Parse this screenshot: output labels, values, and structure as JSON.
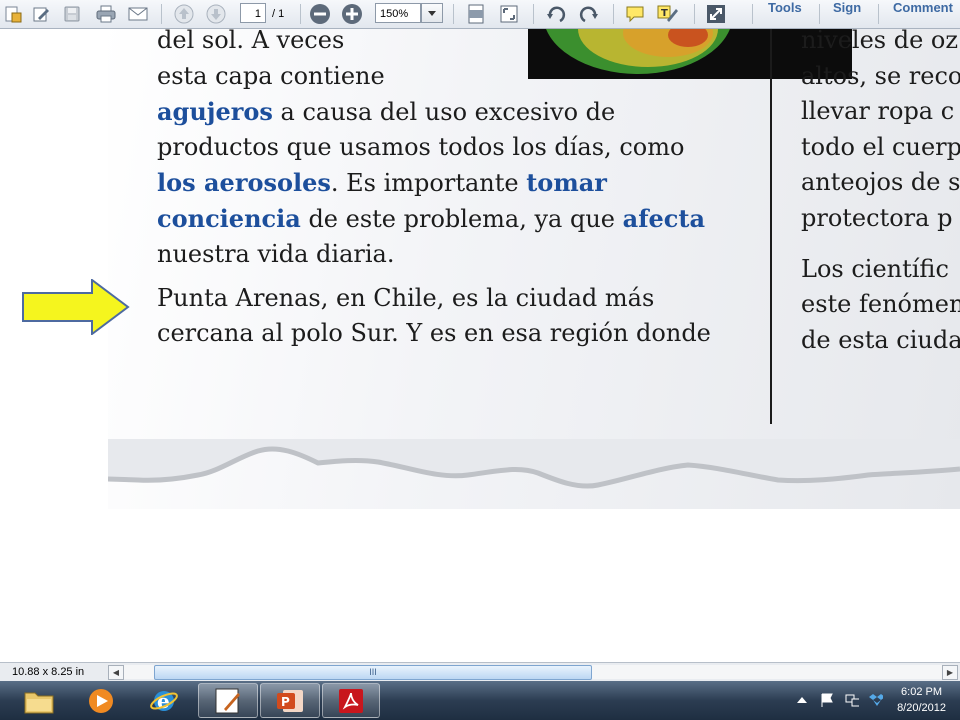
{
  "toolbar": {
    "page_current": "1",
    "page_total": "/ 1",
    "zoom": "150%",
    "links": {
      "tools": "Tools",
      "sign": "Sign",
      "comment": "Comment"
    }
  },
  "document": {
    "right_column": [
      "niveles de oz",
      "altos, se reco",
      "llevar ropa c",
      "todo el cuerp",
      "anteojos de s",
      "protectora p",
      "Los científic",
      "este fenómen",
      "de esta ciuda"
    ],
    "left_column": {
      "line1": "del sol. A veces",
      "line2": "esta capa contiene",
      "line3_hl": "agujeros",
      "line3_rest": " a causa del uso excesivo de",
      "line4": "productos que usamos todos los días, como",
      "line5_hl1": "los aerosoles",
      "line5_mid": ". Es importante ",
      "line5_hl2": "tomar",
      "line6_hl1": "conciencia",
      "line6_mid": " de este problema, ya que ",
      "line6_hl2": "afecta",
      "line7": "nuestra vida diaria.",
      "para2_line1": "Punta Arenas, en Chile, es la ciudad más",
      "para2_line2": "cercana al polo Sur. Y es en esa región donde"
    },
    "highlight_color": "#1d4f9c",
    "arrow_color": "#f5f51e"
  },
  "status": {
    "page_size": "10.88 x 8.25 in",
    "scroll_thumb_grip": "III"
  },
  "taskbar": {
    "apps": [
      "explorer-folder",
      "media-player",
      "internet-explorer",
      "powerpoint-edit",
      "powerpoint",
      "adobe-reader"
    ],
    "time": "6:02 PM",
    "date": "8/20/2012"
  }
}
